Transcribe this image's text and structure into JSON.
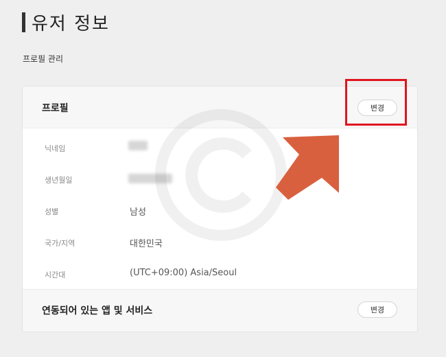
{
  "header": {
    "title": "유저 정보"
  },
  "section": {
    "label": "프로필 관리"
  },
  "profile_card": {
    "title": "프로필",
    "edit_label": "변경",
    "rows": [
      {
        "label": "닉네임",
        "value": ""
      },
      {
        "label": "생년월일",
        "value": ""
      },
      {
        "label": "성별",
        "value": "남성"
      },
      {
        "label": "국가/지역",
        "value": "대한민국"
      },
      {
        "label": "시간대",
        "value": "(UTC+09:00) Asia/Seoul"
      }
    ]
  },
  "services_card": {
    "title": "연동되어 있는 앱 및 서비스",
    "edit_label": "변경"
  },
  "colors": {
    "highlight": "#e0141e",
    "arrow": "#d9603e",
    "background": "#efefef"
  },
  "icons": {
    "watermark": "copyright-icon",
    "annotation": "arrow-up-right-icon"
  }
}
